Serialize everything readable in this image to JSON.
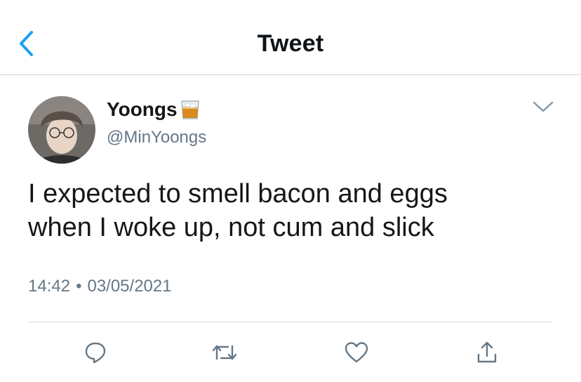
{
  "nav": {
    "title": "Tweet",
    "back_icon": "chevron-left-icon"
  },
  "tweet": {
    "author": {
      "display_name": "Yoongs",
      "name_emoji": "tumbler-glass-icon",
      "handle": "@MinYoongs"
    },
    "text_lines": [
      "I expected to smell bacon and eggs",
      "when I woke up, not cum and slick"
    ],
    "time": "14:42",
    "separator": "•",
    "date": "03/05/2021"
  },
  "actions": [
    "reply-icon",
    "retweet-icon",
    "like-icon",
    "share-icon"
  ],
  "colors": {
    "accent": "#1da1f2",
    "secondary_text": "#657786",
    "icon_gray": "#657786"
  }
}
